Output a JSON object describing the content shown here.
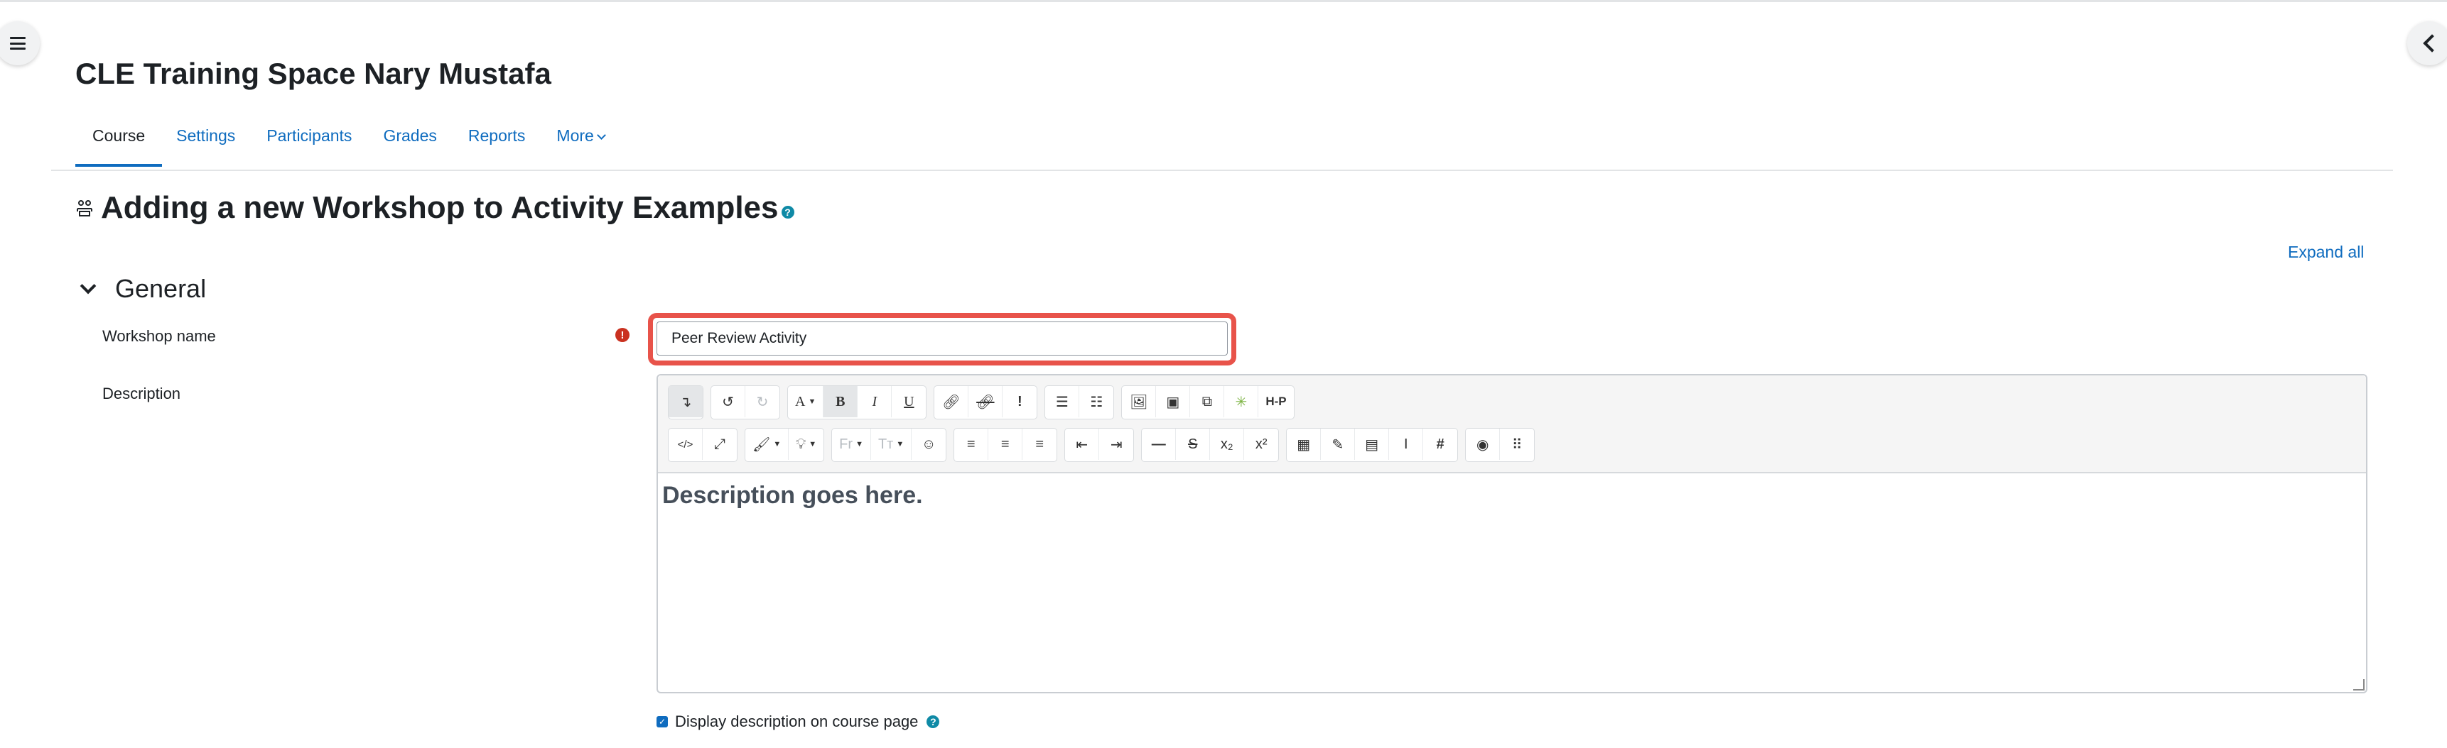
{
  "course": {
    "title": "CLE Training Space Nary Mustafa"
  },
  "nav": {
    "tabs": [
      {
        "label": "Course"
      },
      {
        "label": "Settings"
      },
      {
        "label": "Participants"
      },
      {
        "label": "Grades"
      },
      {
        "label": "Reports"
      },
      {
        "label": "More"
      }
    ],
    "active": "Course"
  },
  "page": {
    "title": "Adding a new Workshop to Activity Examples",
    "help_glyph": "?",
    "expand_all": "Expand all"
  },
  "section": {
    "title": "General"
  },
  "form": {
    "workshop_name_label": "Workshop name",
    "required_glyph": "!",
    "workshop_name_value": "Peer Review Activity",
    "description_label": "Description",
    "editor_content": "Description goes here.",
    "display_description_label": "Display description on course page",
    "display_description_checked": true,
    "help_glyph": "?"
  },
  "toolbar": {
    "font_family_placeholder": "Fr",
    "font_size_placeholder": "Tт",
    "hp_label": "H-P",
    "bold_label": "B",
    "italic_label": "I",
    "underline_label": "U",
    "font_color_label": "A",
    "superscript_label": "x²",
    "subscript_label": "x₂",
    "strike_label": "S",
    "hash_label": "#",
    "exclaim_label": "!",
    "code_label": "</>"
  },
  "colors": {
    "link": "#0f6cbf",
    "highlight": "#e8534a",
    "required": "#ca3120",
    "help": "#0f8aa6"
  }
}
